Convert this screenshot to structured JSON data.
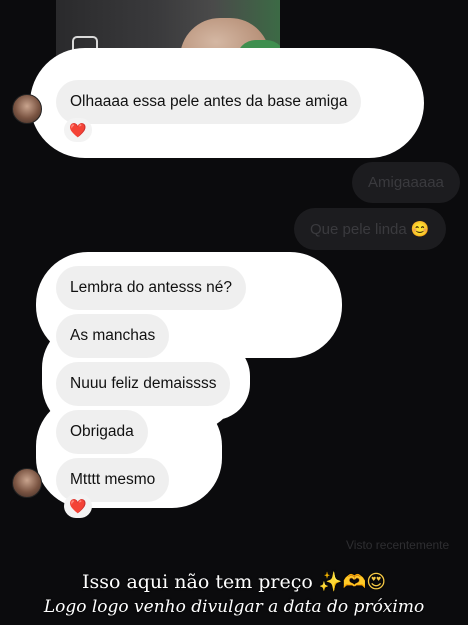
{
  "chat": {
    "incoming_first": {
      "text": "Olhaaaa essa pele antes da base amiga",
      "reaction": "❤️"
    },
    "outgoing": [
      {
        "text": "Amigaaaaa"
      },
      {
        "text": "Que pele linda 😊"
      }
    ],
    "incoming_group": [
      {
        "text": "Lembra do antesss né?"
      },
      {
        "text": "As manchas"
      },
      {
        "text": "Nuuu feliz demaissss"
      },
      {
        "text": "Obrigada"
      },
      {
        "text": "Mtttt mesmo"
      }
    ],
    "group_reaction": "❤️",
    "seen_label": "Visto recentemente"
  },
  "caption": {
    "line1": "Isso aqui não tem preço",
    "line1_emoji_1": "✨",
    "line1_emoji_2": "🫶",
    "line1_emoji_3": "😍",
    "line2": "Logo logo venho divulgar a data do próximo"
  },
  "icons": {
    "avatar": "avatar-icon",
    "reaction": "heart-icon"
  },
  "colors": {
    "background": "#0b0b0d",
    "bubble": "#efefef",
    "sticker": "#ffffff",
    "heart": "#e5333a"
  }
}
